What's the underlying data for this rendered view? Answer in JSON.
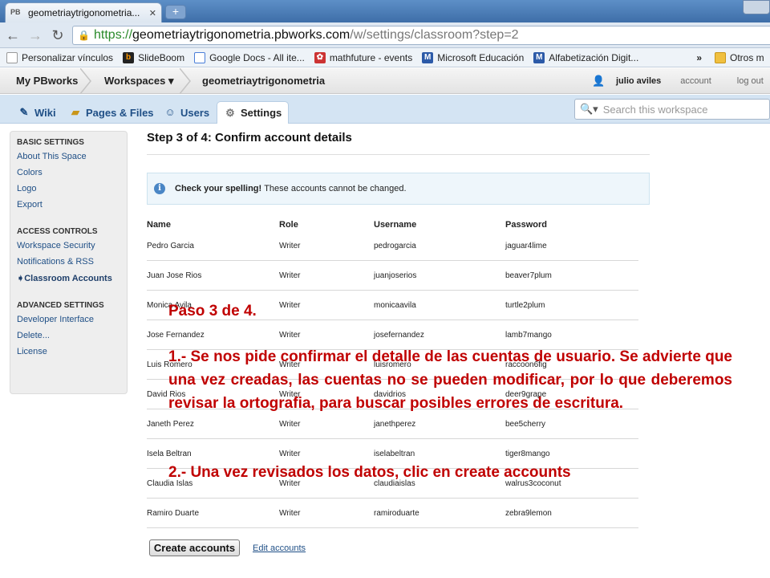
{
  "browser": {
    "tab_title": "geometriaytrigonometria...",
    "tab_favicon": "PB",
    "close_tab": "✕",
    "new_tab": "+",
    "url_scheme": "https://",
    "url_host": "geometriaytrigonometria.pbworks.com",
    "url_path": "/w/settings/classroom?step=2"
  },
  "bookmarks": [
    {
      "label": "Personalizar vínculos",
      "icon": "page-icon"
    },
    {
      "label": "SlideBoom",
      "icon": "slideboom-icon"
    },
    {
      "label": "Google Docs - All ite...",
      "icon": "docs-icon"
    },
    {
      "label": "mathfuture - events",
      "icon": "plant-icon"
    },
    {
      "label": "Microsoft Educación",
      "icon": "ms-icon"
    },
    {
      "label": "Alfabetización Digit...",
      "icon": "ms-icon"
    }
  ],
  "bookmarks_more": "»",
  "bookmarks_other": "Otros m",
  "header": {
    "my_pbworks": "My PBworks",
    "workspaces": "Workspaces",
    "workspace_name": "geometriaytrigonometria",
    "user_name": "julio aviles",
    "account": "account",
    "logout": "log out"
  },
  "tabs": [
    {
      "label": "Wiki",
      "icon": "pencil-icon"
    },
    {
      "label": "Pages & Files",
      "icon": "folder-icon"
    },
    {
      "label": "Users",
      "icon": "user-icon"
    },
    {
      "label": "Settings",
      "icon": "gear-icon"
    }
  ],
  "search": {
    "placeholder": "Search this workspace"
  },
  "sidebar": {
    "basic_title": "BASIC SETTINGS",
    "basic": [
      "About This Space",
      "Colors",
      "Logo",
      "Export"
    ],
    "access_title": "ACCESS CONTROLS",
    "access": [
      "Workspace Security",
      "Notifications & RSS",
      "Classroom Accounts"
    ],
    "advanced_title": "ADVANCED SETTINGS",
    "advanced": [
      "Developer Interface",
      "Delete...",
      "License"
    ]
  },
  "main": {
    "step_title": "Step 3 of 4: Confirm account details",
    "notice_bold": "Check your spelling!",
    "notice_text": "These accounts cannot be changed.",
    "columns": [
      "Name",
      "Role",
      "Username",
      "Password"
    ],
    "rows": [
      [
        "Pedro Garcia",
        "Writer",
        "pedrogarcia",
        "jaguar4lime"
      ],
      [
        "Juan Jose Rios",
        "Writer",
        "juanjoserios",
        "beaver7plum"
      ],
      [
        "Monica Avila",
        "Writer",
        "monicaavila",
        "turtle2plum"
      ],
      [
        "Jose Fernandez",
        "Writer",
        "josefernandez",
        "lamb7mango"
      ],
      [
        "Luis Romero",
        "Writer",
        "luisromero",
        "raccoon6fig"
      ],
      [
        "David Rios",
        "Writer",
        "davidrios",
        "deer9grape"
      ],
      [
        "Janeth Perez",
        "Writer",
        "janethperez",
        "bee5cherry"
      ],
      [
        "Isela Beltran",
        "Writer",
        "iselabeltran",
        "tiger8mango"
      ],
      [
        "Claudia Islas",
        "Writer",
        "claudiaislas",
        "walrus3coconut"
      ],
      [
        "Ramiro Duarte",
        "Writer",
        "ramiroduarte",
        "zebra9lemon"
      ]
    ],
    "create_button": "Create accounts",
    "edit_link": "Edit accounts"
  },
  "annotation": {
    "title": "Paso 3 de 4.",
    "p1": "1.- Se nos pide confirmar el detalle de las cuentas de usuario. Se advierte que una vez creadas, las cuentas no se pueden modificar, por lo que deberemos revisar la ortografia, para buscar posibles errores de escritura.",
    "p2": "2.- Una vez revisados los datos, clic en create accounts",
    "color": "#c00000"
  }
}
